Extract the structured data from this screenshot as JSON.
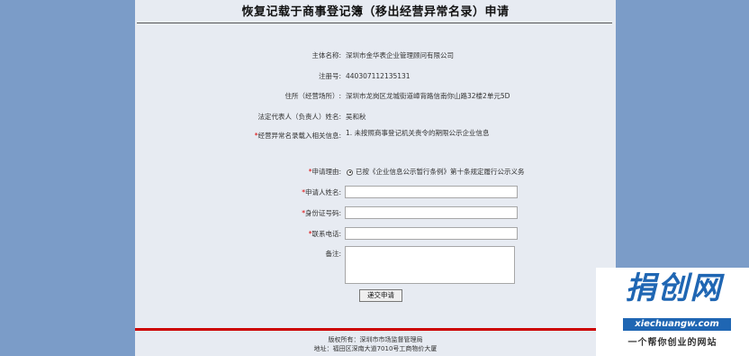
{
  "page": {
    "title": "恢复记载于商事登记簿（移出经营异常名录）申请"
  },
  "info": [
    {
      "label": "主体名称:",
      "value": "深圳市金华表企业管理顾问有限公司",
      "required": ""
    },
    {
      "label": "注册号:",
      "value": "440307112135131",
      "required": ""
    },
    {
      "label": "住所（经营场所）:",
      "value": "深圳市龙岗区龙城街道嶂背路信南你山路32楼2单元5D",
      "required": ""
    },
    {
      "label": "法定代表人（负责人）姓名:",
      "value": "吴和秋",
      "required": ""
    },
    {
      "label": "经营异常名录载入相关信息:",
      "value": "1.   未按照商事登记机关责令的期限公示企业信息",
      "required": "*"
    }
  ],
  "form": {
    "reason_label": "申请理由:",
    "reason_option": "已按《企业信息公示暂行条例》第十条规定履行公示义务",
    "name_label": "申请人姓名:",
    "id_label": "身份证号码:",
    "phone_label": "联系电话:",
    "remark_label": "备注:",
    "required_mark": "*",
    "name_value": "",
    "id_value": "",
    "phone_value": "",
    "remark_value": "",
    "submit_label": "递交申请"
  },
  "footer": {
    "copyright": "版权所有：深圳市市场监督管理局",
    "address": "地址：福田区深南大道7010号工商物价大厦"
  },
  "watermark": {
    "brand": "捐创网",
    "url": "xiechuangw.com",
    "slogan": "一个帮你创业的网站"
  }
}
